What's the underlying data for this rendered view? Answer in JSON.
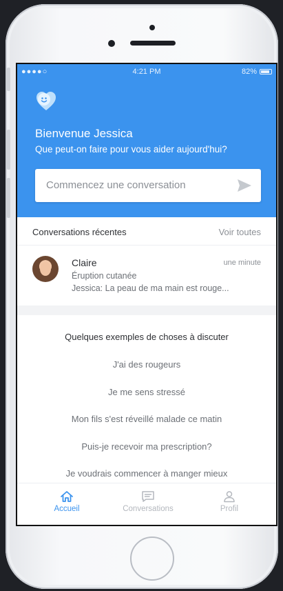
{
  "status_bar": {
    "signal": "●●●●○",
    "time": "4:21 PM",
    "battery": "82%"
  },
  "header": {
    "greeting": "Bienvenue Jessica",
    "subtitle": "Que peut-on faire pour vous aider aujourd'hui?",
    "input_placeholder": "Commencez une conversation"
  },
  "recent": {
    "title": "Conversations récentes",
    "see_all": "Voir toutes",
    "items": [
      {
        "name": "Claire",
        "time": "une minute",
        "topic": "Éruption cutanée",
        "preview": "Jessica: La peau de ma main est rouge..."
      }
    ]
  },
  "examples": {
    "title": "Quelques exemples de choses à discuter",
    "items": [
      "J'ai des rougeurs",
      "Je me sens stressé",
      "Mon fils s'est réveillé malade ce matin",
      "Puis-je recevoir ma prescription?",
      "Je voudrais commencer à manger mieux"
    ]
  },
  "tabs": [
    {
      "label": "Accueil",
      "icon": "home-icon",
      "active": true
    },
    {
      "label": "Conversations",
      "icon": "chat-icon",
      "active": false
    },
    {
      "label": "Profil",
      "icon": "profile-icon",
      "active": false
    }
  ],
  "colors": {
    "accent": "#3b93ee",
    "background": "#f2f3f5",
    "device_bg": "#1f2126"
  }
}
